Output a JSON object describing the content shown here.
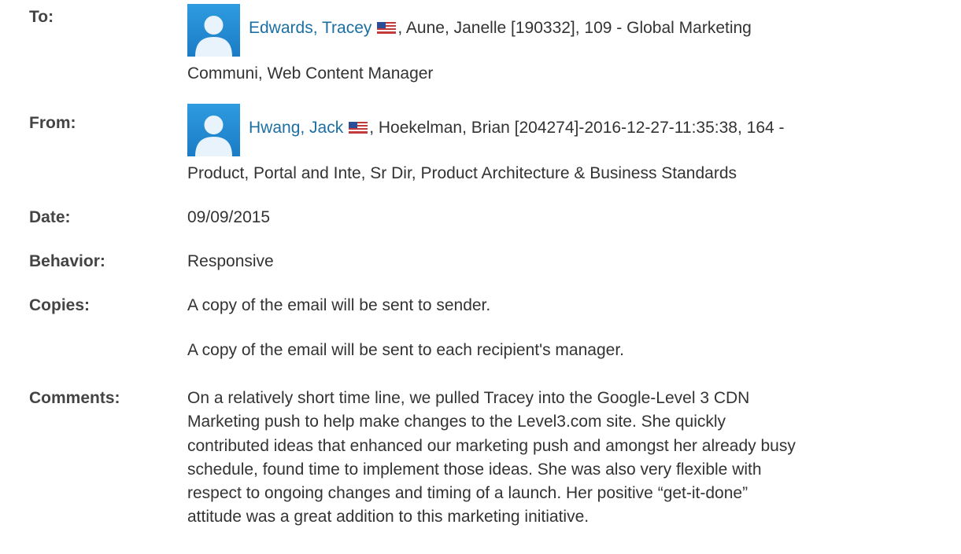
{
  "to": {
    "label": "To:",
    "recipient_name": "Edwards, Tracey",
    "recipient_details_line1": ", Aune, Janelle [190332], 109 - Global Marketing",
    "recipient_details_line2": "Communi, Web Content Manager",
    "avatar_icon": "user-avatar-icon",
    "flag_icon": "us-flag-icon"
  },
  "from": {
    "label": "From:",
    "sender_name": "Hwang, Jack",
    "sender_details_line1": ", Hoekelman, Brian [204274]-2016-12-27-11:35:38, 164 -",
    "sender_details_line2": "Product, Portal and Inte, Sr Dir, Product Architecture & Business Standards",
    "avatar_icon": "user-avatar-icon",
    "flag_icon": "us-flag-icon"
  },
  "date": {
    "label": "Date:",
    "value": "09/09/2015"
  },
  "behavior": {
    "label": "Behavior:",
    "value": "Responsive"
  },
  "copies": {
    "label": "Copies:",
    "line1": "A copy of the email will be sent to sender.",
    "line2": "A copy of the email will be sent to each recipient's manager."
  },
  "comments": {
    "label": "Comments:",
    "text": "On a relatively short time line, we pulled Tracey into the Google-Level 3 CDN\nMarketing push to help make changes to the Level3.com site. She quickly\ncontributed ideas that enhanced our marketing push and amongst her already busy\nschedule, found time to implement those ideas. She was also very flexible with\nrespect to ongoing changes and timing of a launch. Her positive “get-it-done”\nattitude was a great addition to this marketing initiative."
  },
  "colors": {
    "link": "#1b6fa3",
    "label": "#444444",
    "text": "#333333",
    "avatar_bg": "#2f9be0"
  }
}
